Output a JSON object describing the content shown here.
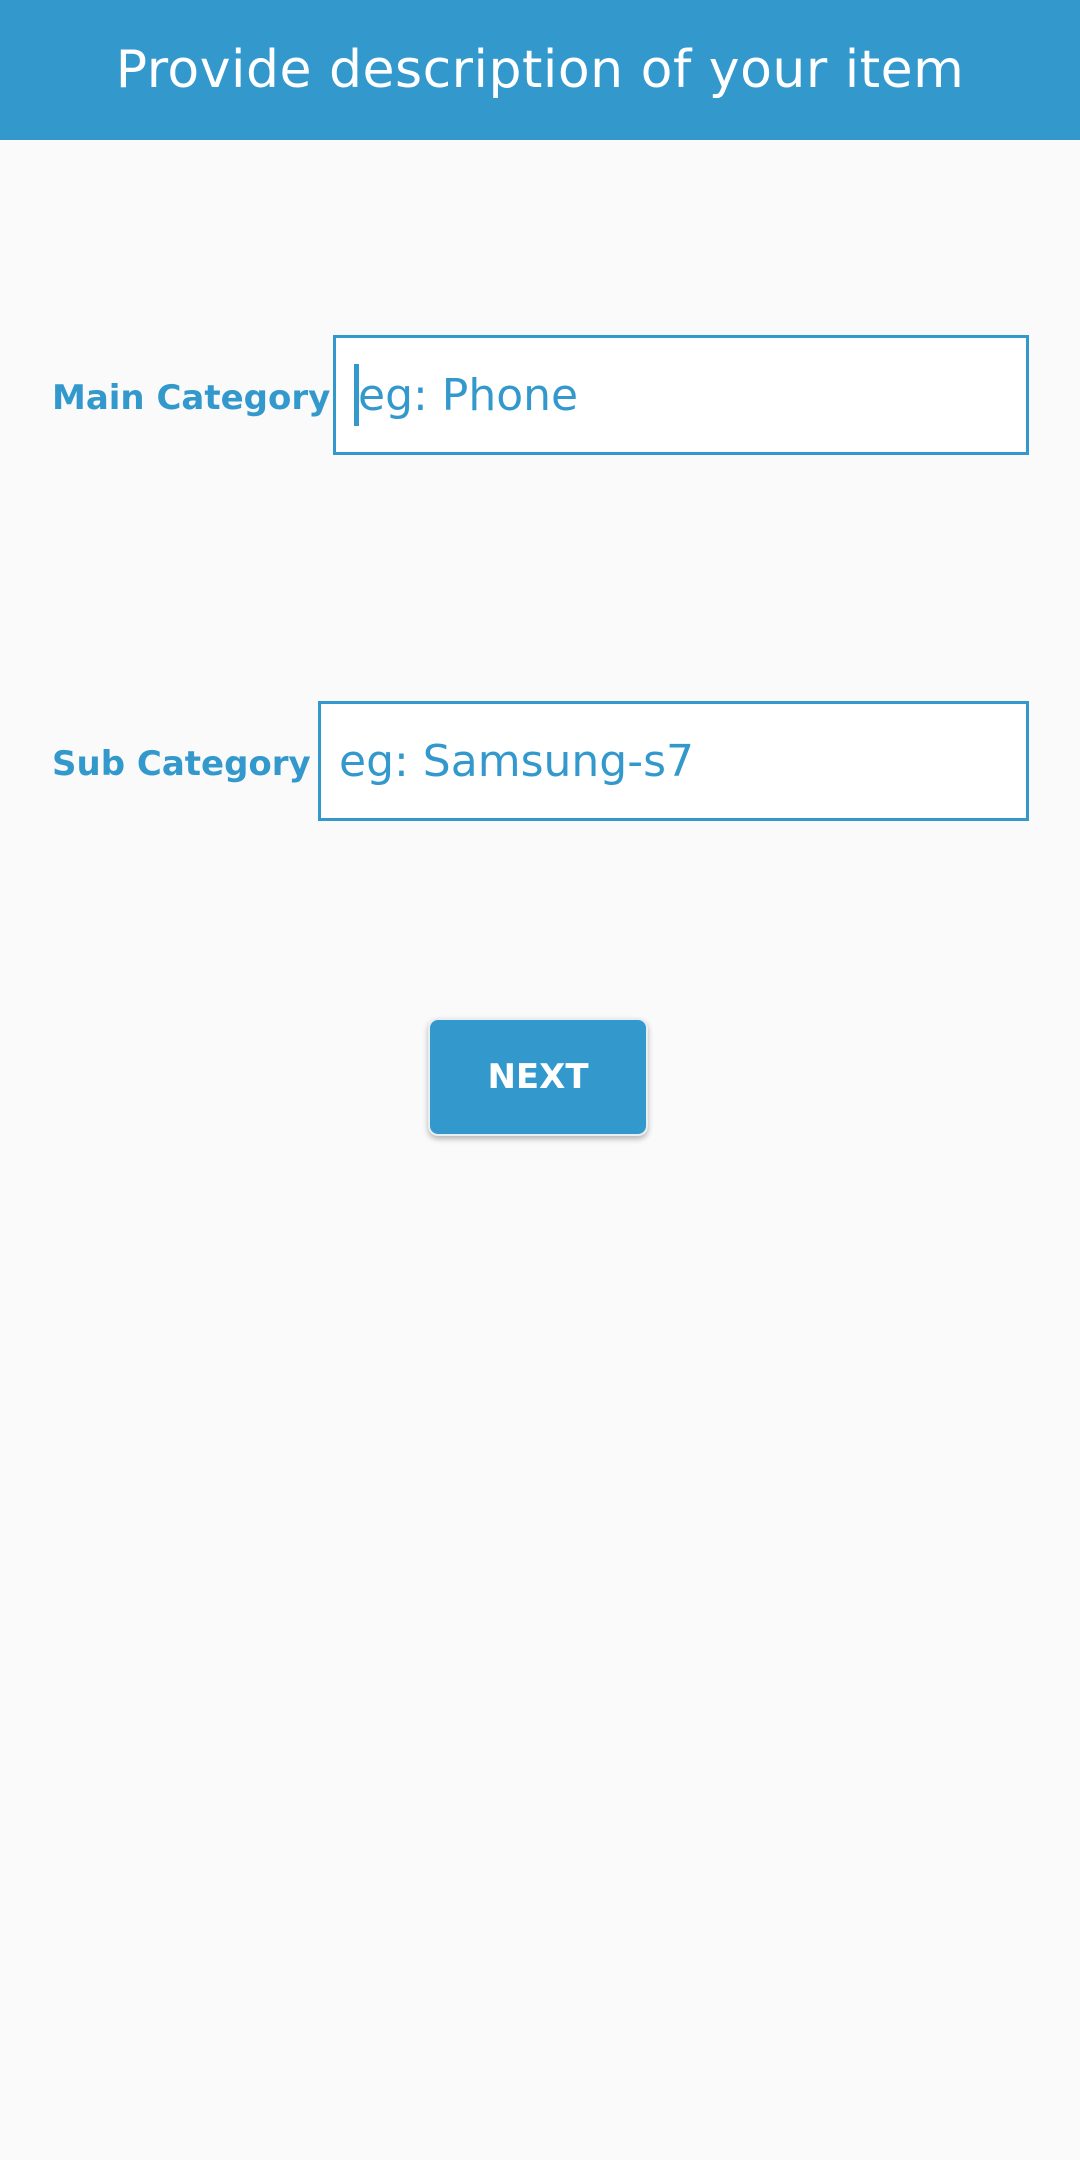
{
  "app_bar": {
    "title": "Provide description of your item"
  },
  "form": {
    "main_category": {
      "label": "Main Category",
      "placeholder": "eg: Phone",
      "value": ""
    },
    "sub_category": {
      "label": "Sub Category",
      "placeholder": "eg: Samsung-s7",
      "value": ""
    },
    "next_label": "NEXT"
  },
  "colors": {
    "primary": "#3399cc",
    "background": "#fafafa",
    "field_background": "#ffffff",
    "on_primary": "#ffffff"
  }
}
